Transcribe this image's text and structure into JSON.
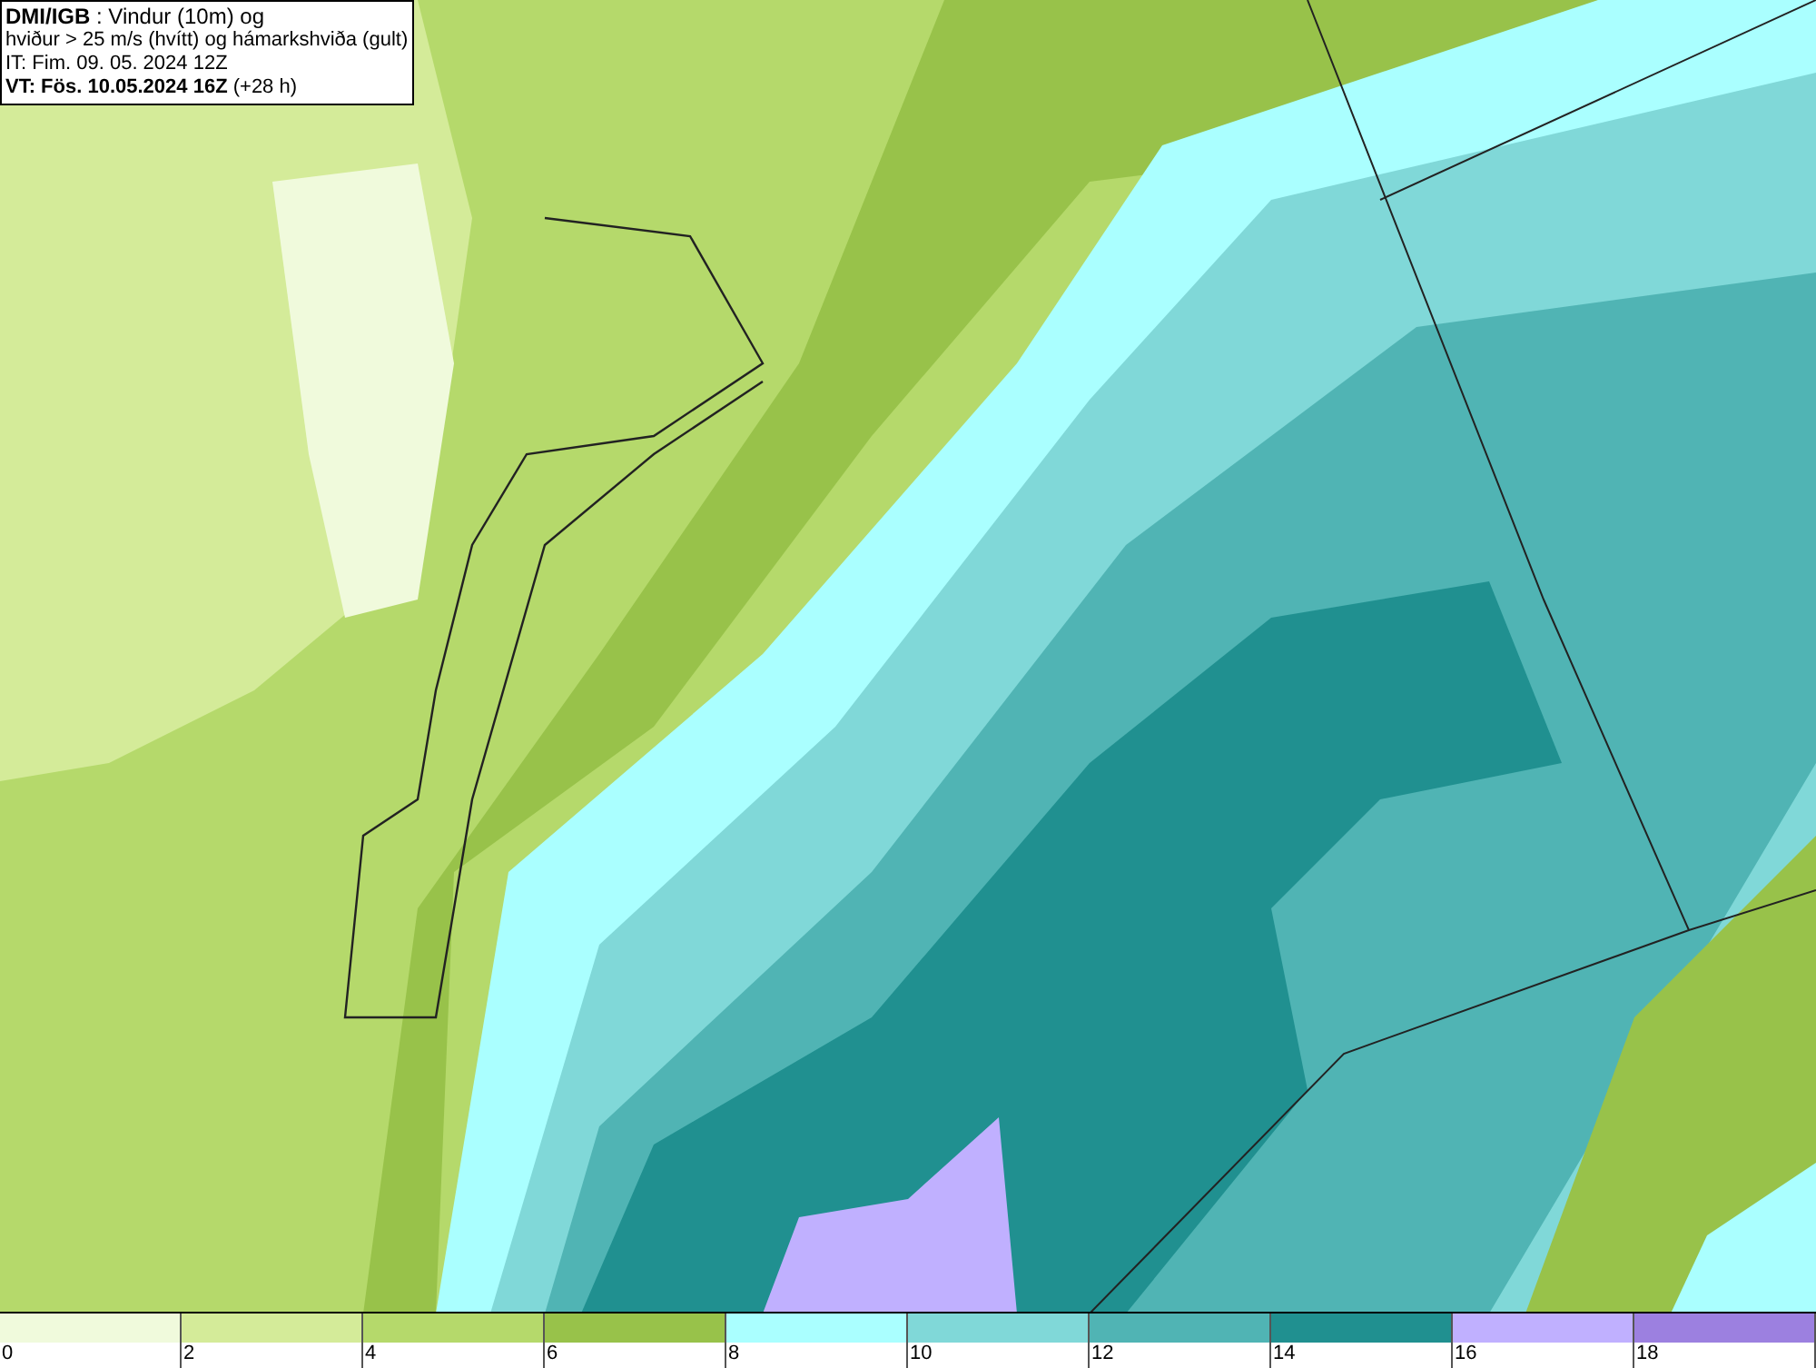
{
  "title_box": {
    "lines": [
      "**DMI/IGB** : Vindur (10m) og",
      "hviður > 25 m/s (hvítt) og hámarkshviða (gult)",
      "IT: Fim. 09. 05. 2024 12Z",
      "**VT: Fös. 10.05.2024 16Z** (+28 h)"
    ]
  },
  "legend": [
    {
      "label": "0",
      "color": "#f0fadc"
    },
    {
      "label": "2",
      "color": "#d4eb99"
    },
    {
      "label": "4",
      "color": "#b5d96b"
    },
    {
      "label": "6",
      "color": "#98c24a"
    },
    {
      "label": "8",
      "color": "#aaffff"
    },
    {
      "label": "10",
      "color": "#80d8d8"
    },
    {
      "label": "12",
      "color": "#50b4b4"
    },
    {
      "label": "14",
      "color": "#209090"
    },
    {
      "label": "16",
      "color": "#c0b0ff"
    },
    {
      "label": "18",
      "color": "#9c80e0"
    }
  ]
}
